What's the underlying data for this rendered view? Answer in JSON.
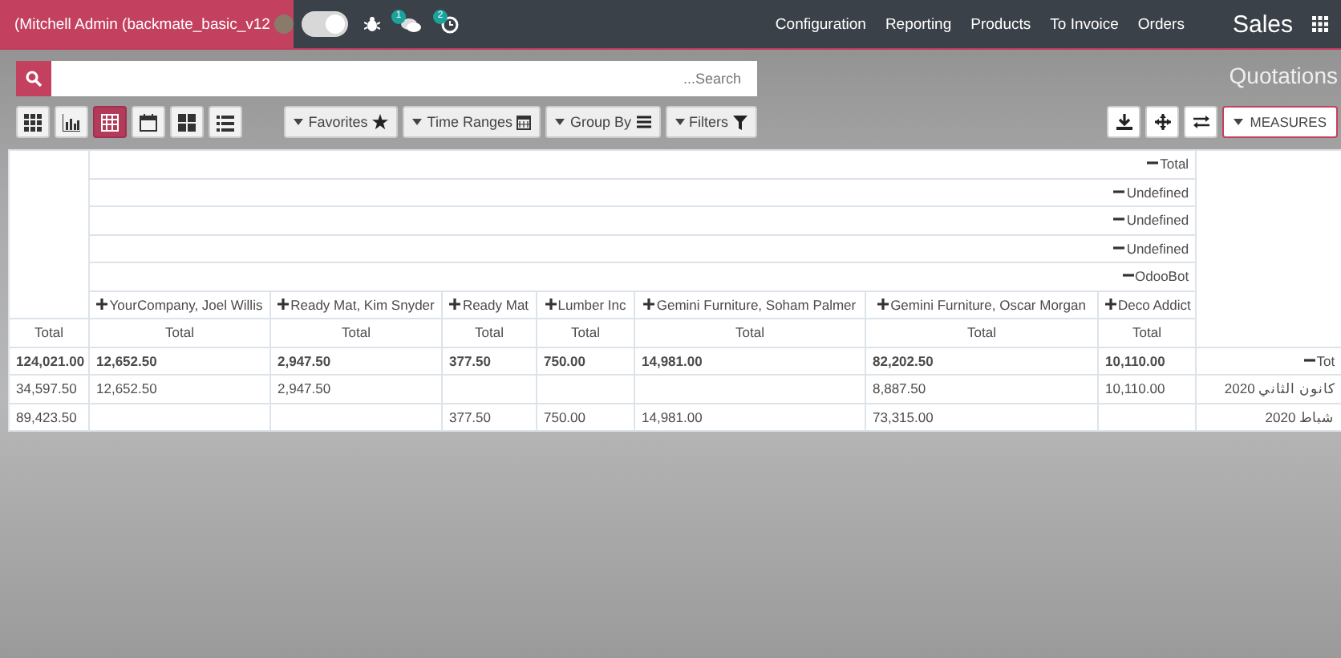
{
  "navbar": {
    "user_menu": "(Mitchell Admin (backmate_basic_v12",
    "toggle": {
      "on": true
    },
    "chat_badge": "1",
    "activity_badge": "2",
    "menu": [
      "Configuration",
      "Reporting",
      "Products",
      "To Invoice",
      "Orders"
    ],
    "app_name": "Sales"
  },
  "breadcrumb": "Quotations",
  "search": {
    "placeholder": "...Search"
  },
  "views": [
    {
      "kind": "grid",
      "selected": false
    },
    {
      "kind": "graph",
      "selected": false
    },
    {
      "kind": "pivot",
      "selected": true
    },
    {
      "kind": "calendar",
      "selected": false
    },
    {
      "kind": "squares",
      "selected": false
    },
    {
      "kind": "list",
      "selected": false
    }
  ],
  "search_options": [
    {
      "label": "Favorites",
      "kind": "star"
    },
    {
      "label": "Time Ranges",
      "kind": "calendar"
    },
    {
      "label": "Group By",
      "kind": "bars"
    },
    {
      "label": "Filters",
      "kind": "filter"
    }
  ],
  "measures_button": "MEASURES",
  "pivot": {
    "header_groups": [
      {
        "label": "Total",
        "expanded": true
      },
      {
        "label": "Undefined",
        "expanded": true
      },
      {
        "label": "Undefined",
        "expanded": true
      },
      {
        "label": "Undefined",
        "expanded": true
      },
      {
        "label": "OdooBot",
        "expanded": true
      }
    ],
    "columns": [
      {
        "label": "YourCompany, Joel Willis",
        "expanded": false
      },
      {
        "label": "Ready Mat, Kim Snyder",
        "expanded": false
      },
      {
        "label": "Ready Mat",
        "expanded": false
      },
      {
        "label": "Lumber Inc",
        "expanded": false
      },
      {
        "label": "Gemini Furniture, Soham Palmer",
        "expanded": false
      },
      {
        "label": "Gemini Furniture, Oscar Morgan",
        "expanded": false
      },
      {
        "label": "Deco Addict",
        "expanded": false
      }
    ],
    "total_measure_label": "Total",
    "measure_labels": [
      "Total",
      "Total",
      "Total",
      "Total",
      "Total",
      "Total",
      "Total"
    ],
    "rows": [
      {
        "label": "Tot",
        "kind": "total",
        "expanded": true,
        "total": "124,021.00",
        "cells": [
          {
            "kind": "value",
            "text": "12,652.50"
          },
          {
            "kind": "value",
            "text": "2,947.50"
          },
          {
            "kind": "value",
            "text": "377.50"
          },
          {
            "kind": "value",
            "text": "750.00"
          },
          {
            "kind": "value",
            "text": "14,981.00"
          },
          {
            "kind": "value",
            "text": "82,202.50"
          },
          {
            "kind": "value",
            "text": "10,110.00"
          }
        ]
      },
      {
        "label": "كانون الثاني 2020",
        "kind": "group",
        "total": "34,597.50",
        "cells": [
          {
            "kind": "value",
            "text": "12,652.50"
          },
          {
            "kind": "value",
            "text": "2,947.50"
          },
          {
            "kind": "empty"
          },
          {
            "kind": "empty"
          },
          {
            "kind": "empty"
          },
          {
            "kind": "value",
            "text": "8,887.50"
          },
          {
            "kind": "value",
            "text": "10,110.00"
          }
        ]
      },
      {
        "label": "شباط 2020",
        "kind": "group",
        "total": "89,423.50",
        "cells": [
          {
            "kind": "empty"
          },
          {
            "kind": "empty"
          },
          {
            "kind": "value",
            "text": "377.50"
          },
          {
            "kind": "value",
            "text": "750.00"
          },
          {
            "kind": "value",
            "text": "14,981.00"
          },
          {
            "kind": "value",
            "text": "73,315.00"
          },
          {
            "kind": "empty"
          }
        ]
      }
    ]
  }
}
